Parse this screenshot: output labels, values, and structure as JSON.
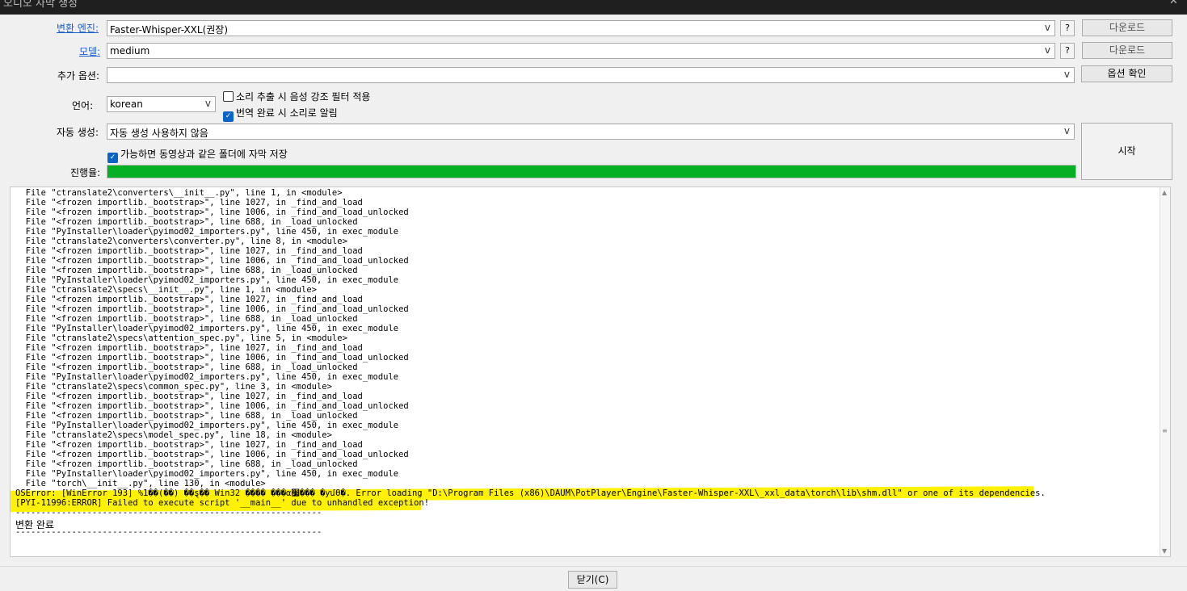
{
  "window": {
    "title": "오디오 자막 생성",
    "buttons": [
      "✕"
    ]
  },
  "engine": {
    "label": "변환 엔진:",
    "value": "Faster-Whisper-XXL(권장)",
    "arrow": "v",
    "help": "?",
    "download": "다운로드"
  },
  "model": {
    "label": "모델:",
    "value": "medium",
    "arrow": "v",
    "help": "?",
    "download": "다운로드"
  },
  "options": {
    "label": "추가 옵션:",
    "value": "",
    "arrow": "v",
    "confirm": "옵션 확인"
  },
  "language": {
    "label": "언어:",
    "value": "korean",
    "arrow": "v"
  },
  "checkboxes": {
    "voice_filter": {
      "label": "소리 추출 시 음성 강조 필터 적용",
      "checked": false
    },
    "notify_sound": {
      "label": "번역 완료 시 소리로 알림",
      "checked": true
    },
    "save_same_folder": {
      "label": "가능하면 동영상과 같은 폴더에 자막 저장",
      "checked": true
    }
  },
  "auto_generate": {
    "label": "자동 생성:",
    "value": "자동 생성 사용하지 않음",
    "arrow": "v"
  },
  "start_button": "시작",
  "progress": {
    "label": "진행율:",
    "percent": 100,
    "color": "#06b025"
  },
  "log": {
    "lines": [
      "  File \"ctranslate2\\converters\\__init__.py\", line 1, in <module>",
      "  File \"<frozen importlib._bootstrap>\", line 1027, in _find_and_load",
      "  File \"<frozen importlib._bootstrap>\", line 1006, in _find_and_load_unlocked",
      "  File \"<frozen importlib._bootstrap>\", line 688, in _load_unlocked",
      "  File \"PyInstaller\\loader\\pyimod02_importers.py\", line 450, in exec_module",
      "  File \"ctranslate2\\converters\\converter.py\", line 8, in <module>",
      "  File \"<frozen importlib._bootstrap>\", line 1027, in _find_and_load",
      "  File \"<frozen importlib._bootstrap>\", line 1006, in _find_and_load_unlocked",
      "  File \"<frozen importlib._bootstrap>\", line 688, in _load_unlocked",
      "  File \"PyInstaller\\loader\\pyimod02_importers.py\", line 450, in exec_module",
      "  File \"ctranslate2\\specs\\__init__.py\", line 1, in <module>",
      "  File \"<frozen importlib._bootstrap>\", line 1027, in _find_and_load",
      "  File \"<frozen importlib._bootstrap>\", line 1006, in _find_and_load_unlocked",
      "  File \"<frozen importlib._bootstrap>\", line 688, in _load_unlocked",
      "  File \"PyInstaller\\loader\\pyimod02_importers.py\", line 450, in exec_module",
      "  File \"ctranslate2\\specs\\attention_spec.py\", line 5, in <module>",
      "  File \"<frozen importlib._bootstrap>\", line 1027, in _find_and_load",
      "  File \"<frozen importlib._bootstrap>\", line 1006, in _find_and_load_unlocked",
      "  File \"<frozen importlib._bootstrap>\", line 688, in _load_unlocked",
      "  File \"PyInstaller\\loader\\pyimod02_importers.py\", line 450, in exec_module",
      "  File \"ctranslate2\\specs\\common_spec.py\", line 3, in <module>",
      "  File \"<frozen importlib._bootstrap>\", line 1027, in _find_and_load",
      "  File \"<frozen importlib._bootstrap>\", line 1006, in _find_and_load_unlocked",
      "  File \"<frozen importlib._bootstrap>\", line 688, in _load_unlocked",
      "  File \"PyInstaller\\loader\\pyimod02_importers.py\", line 450, in exec_module",
      "  File \"ctranslate2\\specs\\model_spec.py\", line 18, in <module>",
      "  File \"<frozen importlib._bootstrap>\", line 1027, in _find_and_load",
      "  File \"<frozen importlib._bootstrap>\", line 1006, in _find_and_load_unlocked",
      "  File \"<frozen importlib._bootstrap>\", line 688, in _load_unlocked",
      "  File \"PyInstaller\\loader\\pyimod02_importers.py\", line 450, in exec_module",
      "  File \"torch\\__init__.py\", line 130, in <module>",
      "OSError: [WinError 193] %1��(��) ��ȿ�� Win32 ���� ���α׷��� �ƴմϴ�. Error loading \"D:\\Program Files (x86)\\DAUM\\PotPlayer\\Engine\\Faster-Whisper-XXL\\_xxl_data\\torch\\lib\\shm.dll\" or one of its dependencies.",
      "[PYI-11996:ERROR] Failed to execute script '__main__' due to unhandled exception!"
    ],
    "separator": "------------------------------------------------------------",
    "done_text": "변환 완료"
  },
  "close_button": "닫기(C)"
}
